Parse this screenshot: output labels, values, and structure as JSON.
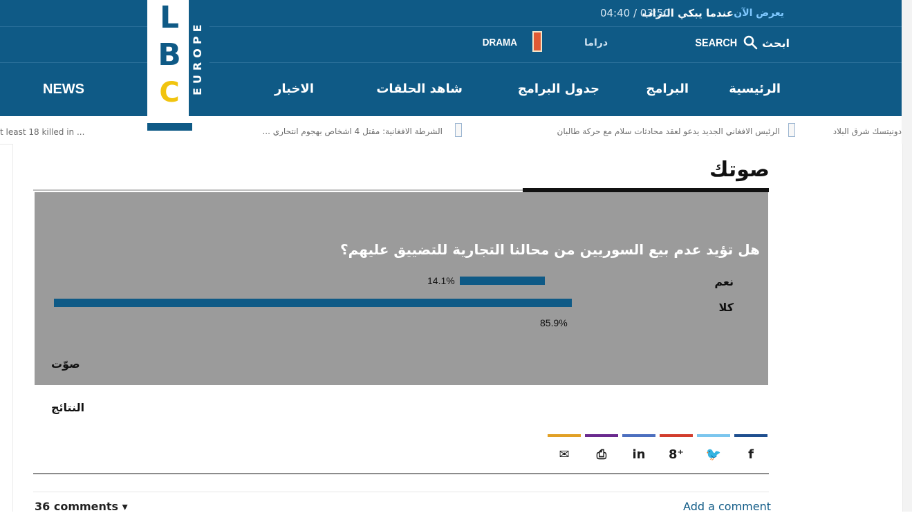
{
  "header": {
    "now_showing_label": "يعرض الآن",
    "now_showing_title": "عندما يبكي التراب",
    "now_showing_time": "04:40 / 03:50",
    "drama_ar": "دراما",
    "drama_en": "DRAMA",
    "search_ar": "ابحث",
    "search_en": "SEARCH",
    "nav": {
      "home": "الرئيسية",
      "programs": "البرامج",
      "schedule": "جدول البرامج",
      "episodes": "شاهد الحلقات",
      "news_ar": "الاخبار",
      "news_en": "NEWS"
    },
    "logo": {
      "letters": [
        "L",
        "B",
        "C"
      ],
      "sub": "EUROPE"
    }
  },
  "ticker": [
    "t least 18 killed in ...",
    "الشرطة الافغانية: مقتل 4 اشخاص بهجوم انتحاري ...",
    "الرئيس الافغاني الجديد يدعو لعقد محادثات سلام مع حركة طالبان",
    "دونيتسك شرق البلاد"
  ],
  "page": {
    "section_title": "صوتك",
    "poll": {
      "question": "هل تؤيد عدم بيع السوريين من محالنا التجارية للتضييق عليهم؟",
      "options": [
        {
          "label": "نعم",
          "percent_text": "14.1%",
          "percent": 0.141
        },
        {
          "label": "كلا",
          "percent_text": "85.9%",
          "percent": 0.859
        }
      ],
      "vote_label": "صوّت",
      "results_label": "النتائج"
    },
    "share": [
      {
        "icon": "facebook-icon",
        "glyph": "f",
        "color": "#1f4f8f"
      },
      {
        "icon": "twitter-icon",
        "glyph": "🐦",
        "color": "#7bc6ee"
      },
      {
        "icon": "google-plus-icon",
        "glyph": "8⁺",
        "color": "#d23d2d"
      },
      {
        "icon": "linkedin-icon",
        "glyph": "in",
        "color": "#4c6fbf"
      },
      {
        "icon": "print-icon",
        "glyph": "⎙",
        "color": "#6a2a8e"
      },
      {
        "icon": "email-icon",
        "glyph": "✉",
        "color": "#e1a026"
      }
    ],
    "comments": {
      "count": "36 comments ▾",
      "add": "Add a comment"
    }
  }
}
